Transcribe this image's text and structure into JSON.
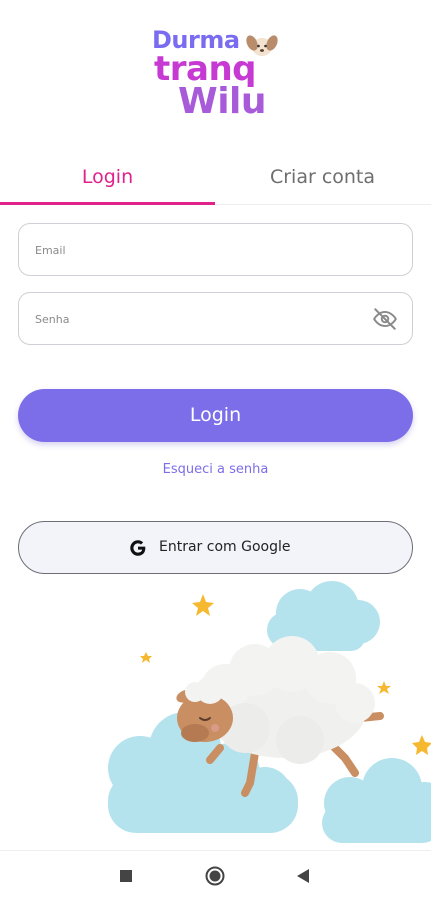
{
  "logo": {
    "line1": "Durma",
    "line2": "tranq",
    "line3": "Wilu",
    "icon": "puppy-icon"
  },
  "tabs": {
    "login": "Login",
    "signup": "Criar conta",
    "active": "login",
    "accent_color": "#e0228a"
  },
  "form": {
    "email_placeholder": "Email",
    "email_value": "",
    "password_placeholder": "Senha",
    "password_value": "",
    "password_toggle_icon": "eye-off-icon"
  },
  "actions": {
    "login_label": "Login",
    "forgot_label": "Esqueci a senha",
    "google_label": "Entrar com Google",
    "primary_color": "#7b6ee8"
  },
  "illustration": {
    "icons": [
      "sleeping-sheep-icon",
      "cloud-icon",
      "star-icon"
    ]
  },
  "navbar": {
    "icons": [
      "recent-apps-icon",
      "home-icon",
      "back-icon"
    ]
  }
}
